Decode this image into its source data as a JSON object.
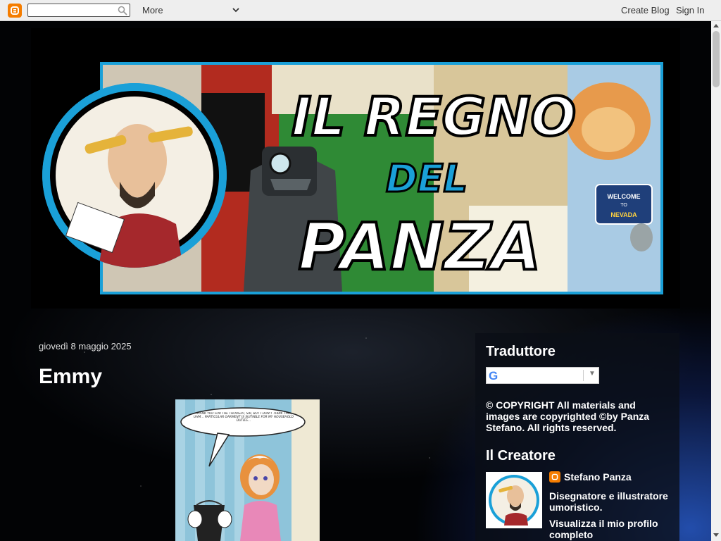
{
  "navbar": {
    "search_placeholder": "",
    "more_label": "More",
    "create_blog_label": "Create Blog",
    "sign_in_label": "Sign In",
    "icons": [
      "blogger-icon",
      "search-icon",
      "chevron-down-icon"
    ]
  },
  "header": {
    "banner_title_line1": "IL REGNO",
    "banner_title_line2": "DEL",
    "banner_title_line3": "PANZA",
    "sign_text_welcome": "WELCOME",
    "sign_text_to": "TO",
    "sign_text_state": "NEVADA"
  },
  "post": {
    "date": "giovedì 8 maggio 2025",
    "title": "Emmy",
    "image_speech": "THANK YOU FOR THE THOUGHT, SIR, BUT I DON'T THINK THIS, UHM... PARTICULAR GARMENT IS SUITABLE FOR MY HOUSEHOLD DUTIES..."
  },
  "sidebar": {
    "translator_title": "Traduttore",
    "translator_select": "",
    "copyright": "© COPYRIGHT All materials and images are copyrighted ©by Panza Stefano. All rights reserved.",
    "creator_title": "Il Creatore",
    "profile_name": "Stefano Panza",
    "profile_desc": "Disegnatore e illustratore umoristico.",
    "profile_link": "Visualizza il mio profilo completo"
  },
  "colors": {
    "blogger_orange": "#f57d00",
    "banner_border": "#1aa0d8",
    "navbar_bg": "#eeeeee"
  }
}
